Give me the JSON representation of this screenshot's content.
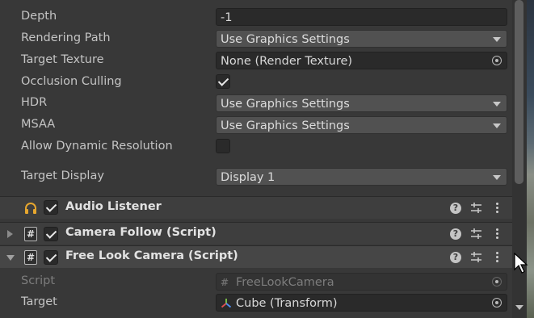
{
  "camera": {
    "depth": {
      "label": "Depth",
      "value": "-1"
    },
    "rendering_path": {
      "label": "Rendering Path",
      "value": "Use Graphics Settings"
    },
    "target_texture": {
      "label": "Target Texture",
      "value": "None (Render Texture)"
    },
    "occlusion_culling": {
      "label": "Occlusion Culling",
      "checked": true
    },
    "hdr": {
      "label": "HDR",
      "value": "Use Graphics Settings"
    },
    "msaa": {
      "label": "MSAA",
      "value": "Use Graphics Settings"
    },
    "allow_dynamic_resolution": {
      "label": "Allow Dynamic Resolution",
      "checked": false
    },
    "target_display": {
      "label": "Target Display",
      "value": "Display 1"
    }
  },
  "components": [
    {
      "title": "Audio Listener",
      "icon": "headphones-icon",
      "enabled": true,
      "expanded": false
    },
    {
      "title": "Camera Follow (Script)",
      "icon": "script-icon",
      "enabled": true,
      "expanded": false
    },
    {
      "title": "Free Look Camera (Script)",
      "icon": "script-icon",
      "enabled": true,
      "expanded": true
    }
  ],
  "free_look": {
    "script": {
      "label": "Script",
      "value": "FreeLookCamera"
    },
    "target": {
      "label": "Target",
      "value": "Cube (Transform)"
    }
  },
  "glyphs": {
    "help": "?",
    "hash": "#"
  }
}
